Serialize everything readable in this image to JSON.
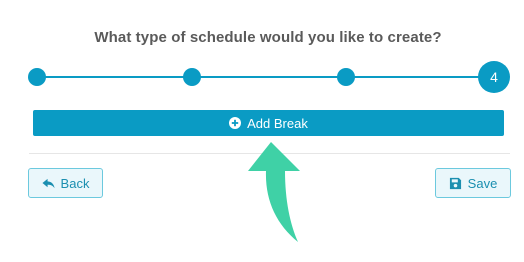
{
  "wizard": {
    "title": "What type of schedule would you like to create?",
    "current_step": "4"
  },
  "actions": {
    "add_break_label": "Add Break",
    "back_label": "Back",
    "save_label": "Save"
  },
  "icons": {
    "add": "plus-circle-icon",
    "back": "reply-arrow-icon",
    "save": "floppy-disk-icon",
    "pointer": "curved-arrow-icon"
  },
  "colors": {
    "primary": "#0a9bc4",
    "outline_border": "#6cc9de",
    "outline_bg": "#eaf7fb",
    "pointer_arrow": "#3fd1a6"
  }
}
